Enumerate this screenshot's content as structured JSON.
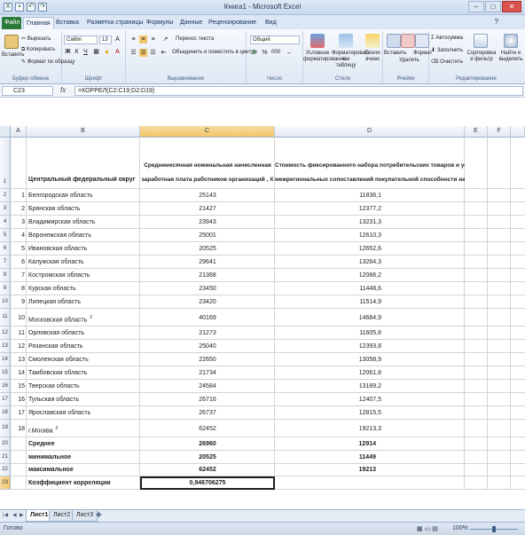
{
  "window": {
    "title": "Книга1 - Microsoft Excel"
  },
  "tabs": [
    "Файл",
    "Главная",
    "Вставка",
    "Разметка страницы",
    "Формулы",
    "Данные",
    "Рецензирование",
    "Вид"
  ],
  "ribbon": {
    "clipboard": {
      "paste": "Вставить",
      "cut": "Вырезать",
      "copy": "Копировать",
      "format_painter": "Формат по образцу",
      "label": "Буфер обмена"
    },
    "font": {
      "name": "Calibri",
      "size": "13",
      "label": "Шрифт",
      "bold": "Ж",
      "italic": "К",
      "underline": "Ч"
    },
    "alignment": {
      "wrap": "Перенос текста",
      "merge": "Объединить и поместить в центре",
      "label": "Выравнивание"
    },
    "number": {
      "format": "Общий",
      "label": "Число",
      "percent": "%",
      "thousands": "000"
    },
    "styles": {
      "conditional": "Условное форматирование",
      "as_table": "Форматировать как таблицу",
      "cell_styles": "Стили ячеек",
      "label": "Стили"
    },
    "cells": {
      "insert": "Вставить",
      "delete": "Удалить",
      "format": "Формат",
      "label": "Ячейки"
    },
    "editing": {
      "autosum": "Автосумма",
      "fill": "Заполнить",
      "clear": "Очистить",
      "sort": "Сортировка и фильтр",
      "find": "Найти и выделить",
      "label": "Редактирование"
    }
  },
  "formula_bar": {
    "name_box": "C23",
    "fx": "fx",
    "formula": "=КОРРЕЛ(C2:C19;D2:D19)"
  },
  "columns": [
    "A",
    "B",
    "C",
    "D",
    "E",
    "F"
  ],
  "header_row": {
    "b": "Центральный федеральный округ",
    "c_line1": "Среднемесячная номинальная начисленная",
    "c_line2": "заработная плата работников организаций , X",
    "d_line1": "Стоимость фиксированного набора потребительских товаров и услуг для",
    "d_line2": "межрегиональных сопоставлений покупательной способности населения , Y"
  },
  "rows": [
    {
      "n": "2",
      "idx": "1",
      "region": "Белгородская область",
      "x": "25143",
      "y": "11836,1"
    },
    {
      "n": "3",
      "idx": "2",
      "region": "Брянская область",
      "x": "21427",
      "y": "12377,2"
    },
    {
      "n": "4",
      "idx": "3",
      "region": "Владимирская область",
      "x": "23943",
      "y": "13231,3"
    },
    {
      "n": "5",
      "idx": "4",
      "region": "Воронежская область",
      "x": "25001",
      "y": "12610,3"
    },
    {
      "n": "6",
      "idx": "5",
      "region": "Ивановская область",
      "x": "20525",
      "y": "12652,6"
    },
    {
      "n": "7",
      "idx": "6",
      "region": "Калужская область",
      "x": "29641",
      "y": "13264,3"
    },
    {
      "n": "8",
      "idx": "7",
      "region": "Костромская область",
      "x": "21368",
      "y": "12086,2"
    },
    {
      "n": "9",
      "idx": "8",
      "region": "Курская область",
      "x": "23450",
      "y": "11448,6"
    },
    {
      "n": "10",
      "idx": "9",
      "region": "Липецкая область",
      "x": "23420",
      "y": "11514,9"
    },
    {
      "n": "11",
      "idx": "10",
      "region": "Московская область",
      "sup": "2",
      "x": "40169",
      "y": "14684,9"
    },
    {
      "n": "12",
      "idx": "11",
      "region": "Орловская область",
      "x": "21273",
      "y": "11605,8"
    },
    {
      "n": "13",
      "idx": "12",
      "region": "Рязанская область",
      "x": "25040",
      "y": "12393,8"
    },
    {
      "n": "14",
      "idx": "13",
      "region": "Смоленская область",
      "x": "22650",
      "y": "13058,9"
    },
    {
      "n": "15",
      "idx": "14",
      "region": "Тамбовская область",
      "x": "21734",
      "y": "12061,8"
    },
    {
      "n": "16",
      "idx": "15",
      "region": "Тверская область",
      "x": "24584",
      "y": "13189,2"
    },
    {
      "n": "17",
      "idx": "16",
      "region": "Тульская область",
      "x": "26716",
      "y": "12407,5"
    },
    {
      "n": "18",
      "idx": "17",
      "region": "Ярославская область",
      "x": "26737",
      "y": "12815,5"
    },
    {
      "n": "19",
      "idx": "18",
      "region": "г.Москва",
      "sup": "2",
      "x": "62452",
      "y": "19213,3"
    }
  ],
  "summary": [
    {
      "n": "20",
      "label": "Среднее",
      "x": "26960",
      "y": "12914"
    },
    {
      "n": "21",
      "label": "минимальное",
      "x": "20525",
      "y": "11449"
    },
    {
      "n": "22",
      "label": "максимальное",
      "x": "62452",
      "y": "19213"
    },
    {
      "n": "23",
      "label": "Коэффициент корреляции",
      "x": "0,946706275",
      "y": ""
    }
  ],
  "sheets": [
    "Лист1",
    "Лист2",
    "Лист3"
  ],
  "status": {
    "ready": "Готово",
    "zoom": "100%"
  }
}
